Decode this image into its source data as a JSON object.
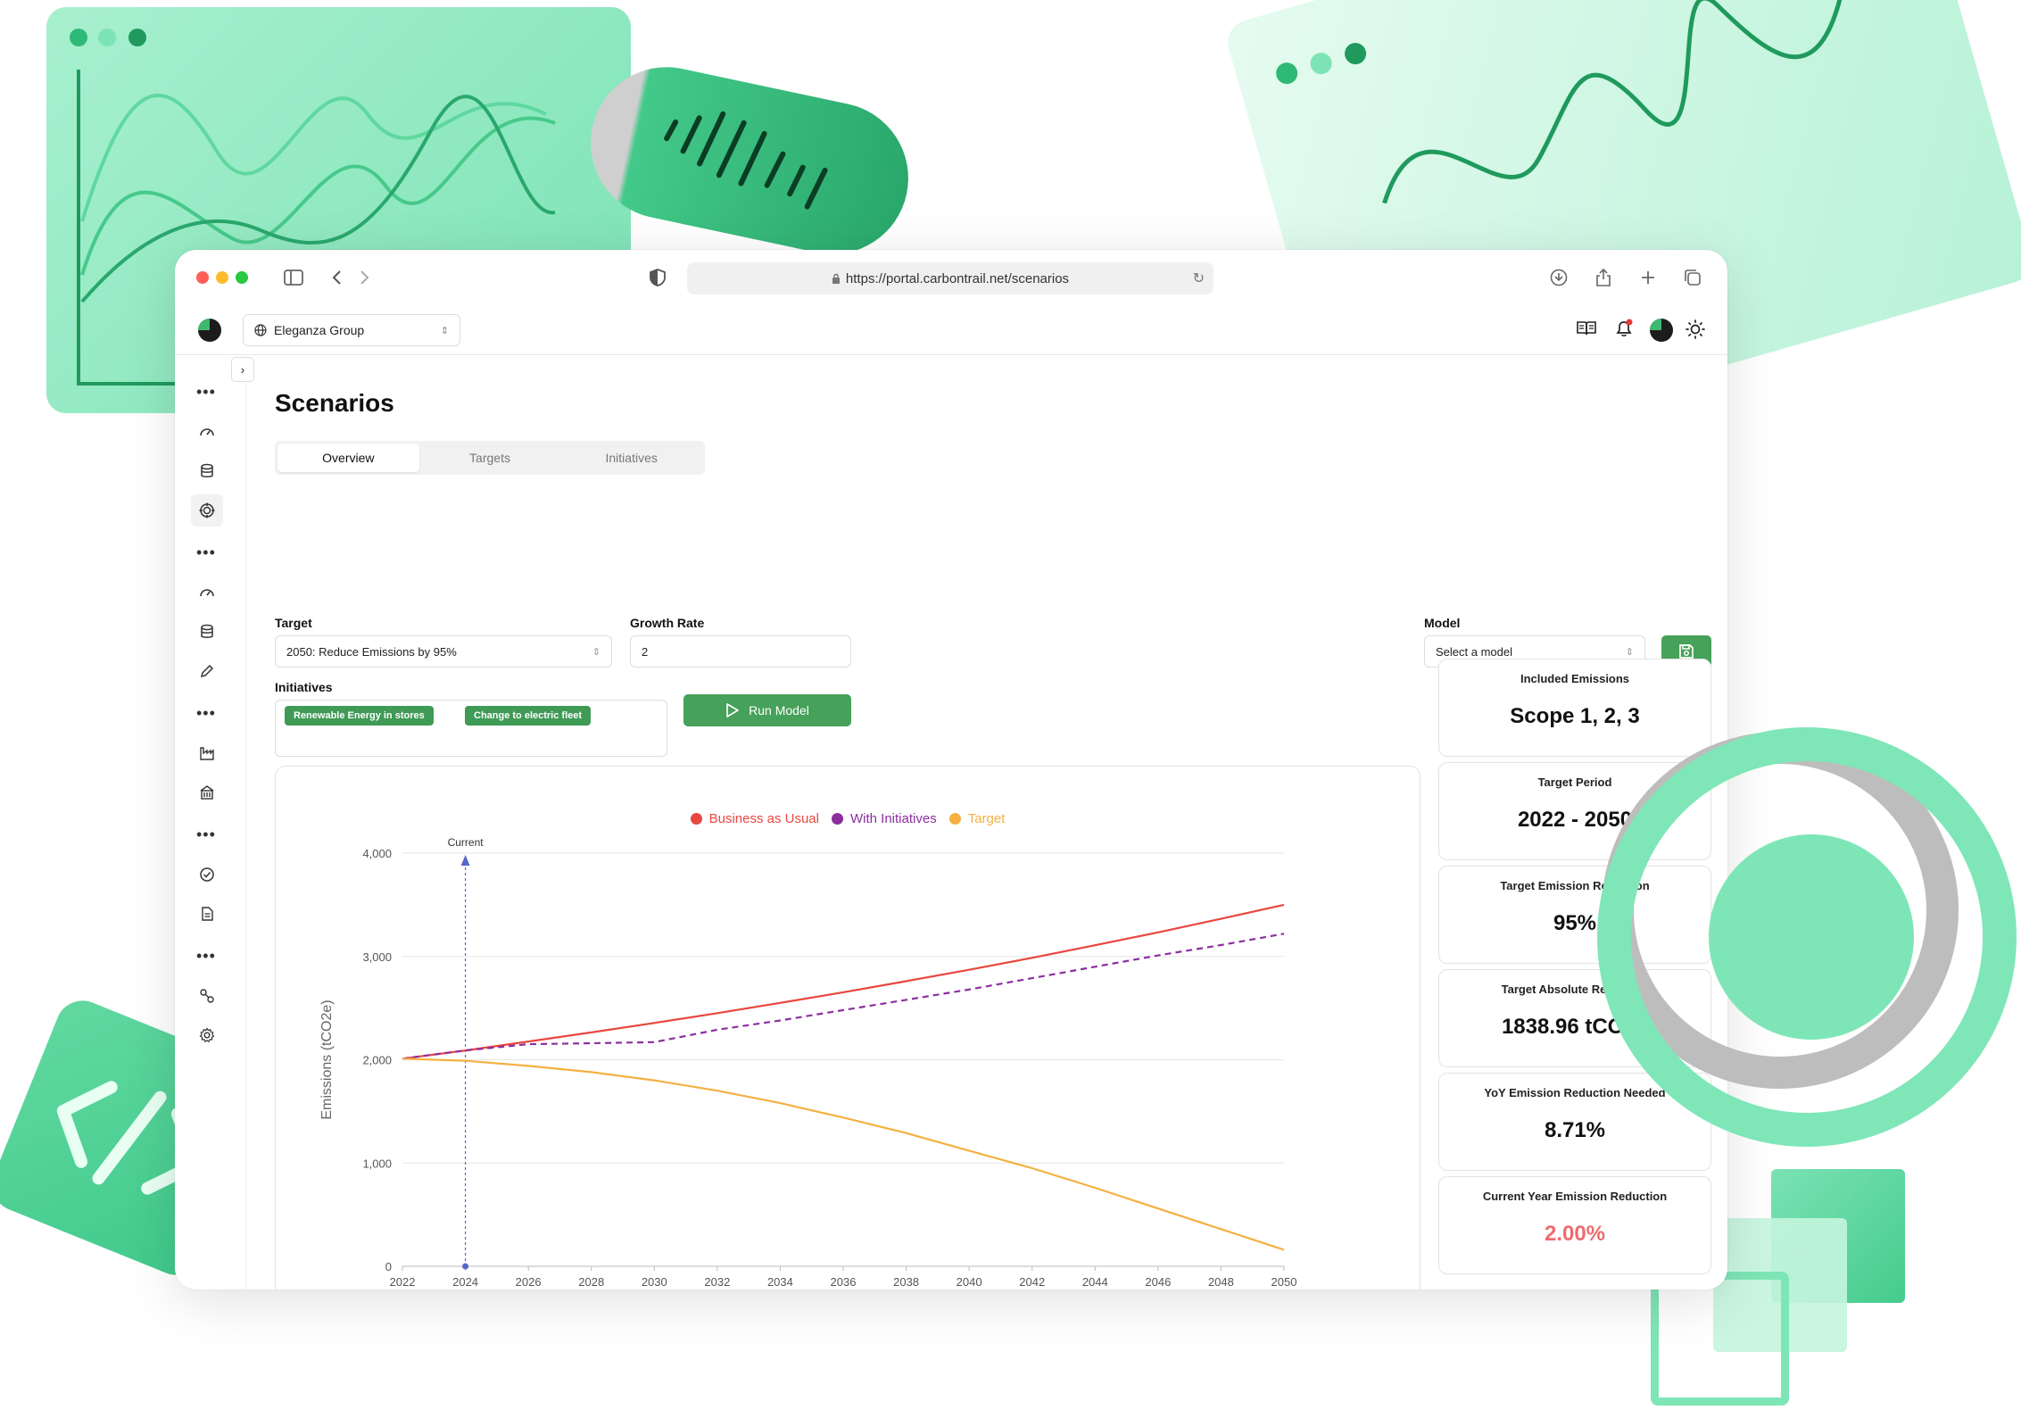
{
  "browser": {
    "url": "https://portal.carbontrail.net/scenarios"
  },
  "app": {
    "organization": "Eleganza Group"
  },
  "page": {
    "title": "Scenarios",
    "tabs": [
      {
        "label": "Overview",
        "active": true
      },
      {
        "label": "Targets",
        "active": false
      },
      {
        "label": "Initiatives",
        "active": false
      }
    ]
  },
  "form": {
    "target_label": "Target",
    "target_value": "2050: Reduce Emissions by 95%",
    "growth_rate_label": "Growth Rate",
    "growth_rate_value": "2",
    "model_label": "Model",
    "model_placeholder": "Select a model",
    "initiatives_label": "Initiatives",
    "initiatives": [
      "Renewable Energy in stores",
      "Change to electric fleet"
    ],
    "run_button": "Run Model"
  },
  "stats": [
    {
      "label": "Included Emissions",
      "value": "Scope 1, 2, 3",
      "highlight": false
    },
    {
      "label": "Target Period",
      "value": "2022 - 2050",
      "highlight": false
    },
    {
      "label": "Target Emission Reduction",
      "value": "95%",
      "highlight": false
    },
    {
      "label": "Target Absolute Reduction",
      "value": "1838.96 tCO2e",
      "highlight": false
    },
    {
      "label": "YoY Emission Reduction Needed",
      "value": "8.71%",
      "highlight": false
    },
    {
      "label": "Current Year Emission Reduction",
      "value": "2.00%",
      "highlight": true
    }
  ],
  "colors": {
    "brand_green": "#46a15a",
    "business_as_usual": "#e8473f",
    "with_initiatives": "#8b2f9e",
    "target": "#f5b041",
    "current_marker": "#5567c9",
    "alert_value": "#ee6b6e"
  },
  "icons": {
    "sidebar": [
      "dashboard-gauge-icon",
      "database-icon",
      "target-icon",
      "dashboard-gauge-icon",
      "database-icon",
      "pencil-icon",
      "factory-icon",
      "building-icon",
      "check-circle-icon",
      "document-icon",
      "link-nodes-icon",
      "settings-gear-icon"
    ]
  },
  "chart_data": {
    "type": "line",
    "title": "",
    "xlabel": "",
    "ylabel": "Emissions (tCO2e)",
    "x_ticks": [
      "2022",
      "2024",
      "2026",
      "2028",
      "2030",
      "2032",
      "2034",
      "2036",
      "2038",
      "2040",
      "2042",
      "2044",
      "2046",
      "2048",
      "2050"
    ],
    "y_ticks": [
      "0",
      "1,000",
      "2,000",
      "3,000",
      "4,000"
    ],
    "ylim": [
      0,
      4000
    ],
    "xlim": [
      2022,
      2050
    ],
    "marker": {
      "label": "Current",
      "x": 2024
    },
    "legend_position": "top-center",
    "series": [
      {
        "name": "Business as Usual",
        "style": "solid",
        "color": "#e8473f",
        "points": [
          [
            2022,
            2010
          ],
          [
            2024,
            2090
          ],
          [
            2026,
            2176
          ],
          [
            2028,
            2264
          ],
          [
            2030,
            2356
          ],
          [
            2032,
            2451
          ],
          [
            2034,
            2550
          ],
          [
            2036,
            2653
          ],
          [
            2038,
            2760
          ],
          [
            2040,
            2871
          ],
          [
            2042,
            2987
          ],
          [
            2044,
            3108
          ],
          [
            2046,
            3233
          ],
          [
            2048,
            3364
          ],
          [
            2050,
            3500
          ]
        ]
      },
      {
        "name": "With Initiatives",
        "style": "dashed",
        "color": "#8b2f9e",
        "points": [
          [
            2022,
            2010
          ],
          [
            2024,
            2090
          ],
          [
            2026,
            2150
          ],
          [
            2028,
            2160
          ],
          [
            2030,
            2170
          ],
          [
            2032,
            2290
          ],
          [
            2034,
            2380
          ],
          [
            2036,
            2480
          ],
          [
            2038,
            2580
          ],
          [
            2040,
            2680
          ],
          [
            2042,
            2790
          ],
          [
            2044,
            2900
          ],
          [
            2046,
            3010
          ],
          [
            2048,
            3110
          ],
          [
            2050,
            3220
          ]
        ]
      },
      {
        "name": "Target",
        "style": "solid",
        "color": "#f5b041",
        "points": [
          [
            2022,
            2010
          ],
          [
            2024,
            1990
          ],
          [
            2026,
            1940
          ],
          [
            2028,
            1880
          ],
          [
            2030,
            1800
          ],
          [
            2032,
            1700
          ],
          [
            2034,
            1580
          ],
          [
            2036,
            1440
          ],
          [
            2038,
            1290
          ],
          [
            2040,
            1120
          ],
          [
            2042,
            950
          ],
          [
            2044,
            760
          ],
          [
            2046,
            560
          ],
          [
            2048,
            360
          ],
          [
            2050,
            160
          ]
        ]
      }
    ]
  }
}
